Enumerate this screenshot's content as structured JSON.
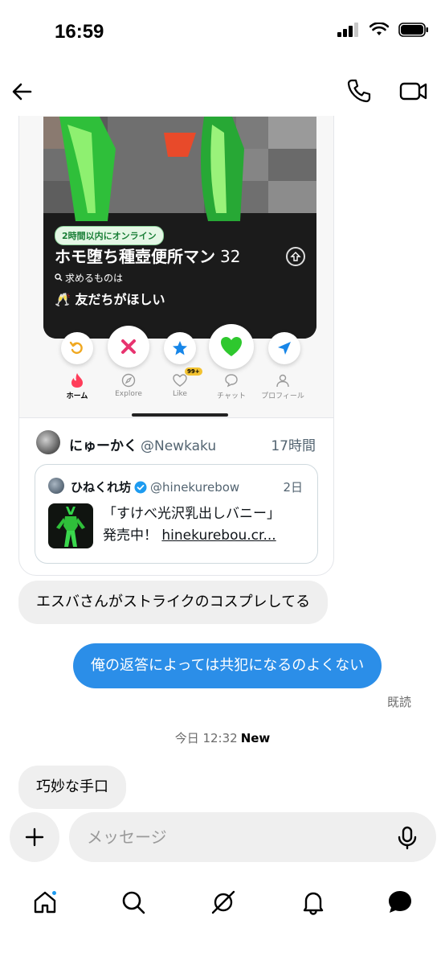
{
  "status_bar": {
    "time": "16:59"
  },
  "top_nav": {
    "back": "arrow-left-icon",
    "call": "phone-icon",
    "video": "video-camera-icon"
  },
  "shared_card": {
    "screenshot": {
      "online_badge": "2時間以内にオンライン",
      "profile_name": "ホモ堕ち種壺便所マン",
      "profile_age": "32",
      "seeking_label": "求めるものは",
      "seeking_value": "友だちがほしい",
      "seeking_emoji": "🥂",
      "app_tabs": [
        {
          "label": "ホーム",
          "icon": "flame-icon"
        },
        {
          "label": "Explore",
          "icon": "compass-icon"
        },
        {
          "label": "Like",
          "icon": "heart-icon",
          "badge": "99+"
        },
        {
          "label": "チャット",
          "icon": "chat-icon"
        },
        {
          "label": "プロフィール",
          "icon": "person-icon"
        }
      ]
    },
    "tweet": {
      "name": "にゅーかく",
      "handle": "@Newkaku",
      "time": "17時間",
      "quote": {
        "name": "ひねくれ坊",
        "handle": "@hinekurebow",
        "time": "2日",
        "line1": "「すけべ光沢乳出しバニー」",
        "line2_prefix": "発売中！",
        "line2_link": "hinekurebou.cr..."
      }
    }
  },
  "messages": [
    {
      "direction": "in",
      "text": "エスバさんがストライクのコスプレしてる"
    },
    {
      "direction": "out",
      "text": "俺の返答によっては共犯になるのよくない"
    },
    {
      "direction": "in",
      "text": "巧妙な手口"
    }
  ],
  "read_status": "既読",
  "timestamp": {
    "label": "今日 12:32",
    "new": "New"
  },
  "composer": {
    "placeholder": "メッセージ"
  },
  "bottom_nav": [
    "home-icon",
    "search-icon",
    "grok-icon",
    "bell-icon",
    "messages-icon"
  ],
  "colors": {
    "accent": "#2b8ee8",
    "bubble_in": "#efefef",
    "notif_dot": "#1d9bf0"
  }
}
